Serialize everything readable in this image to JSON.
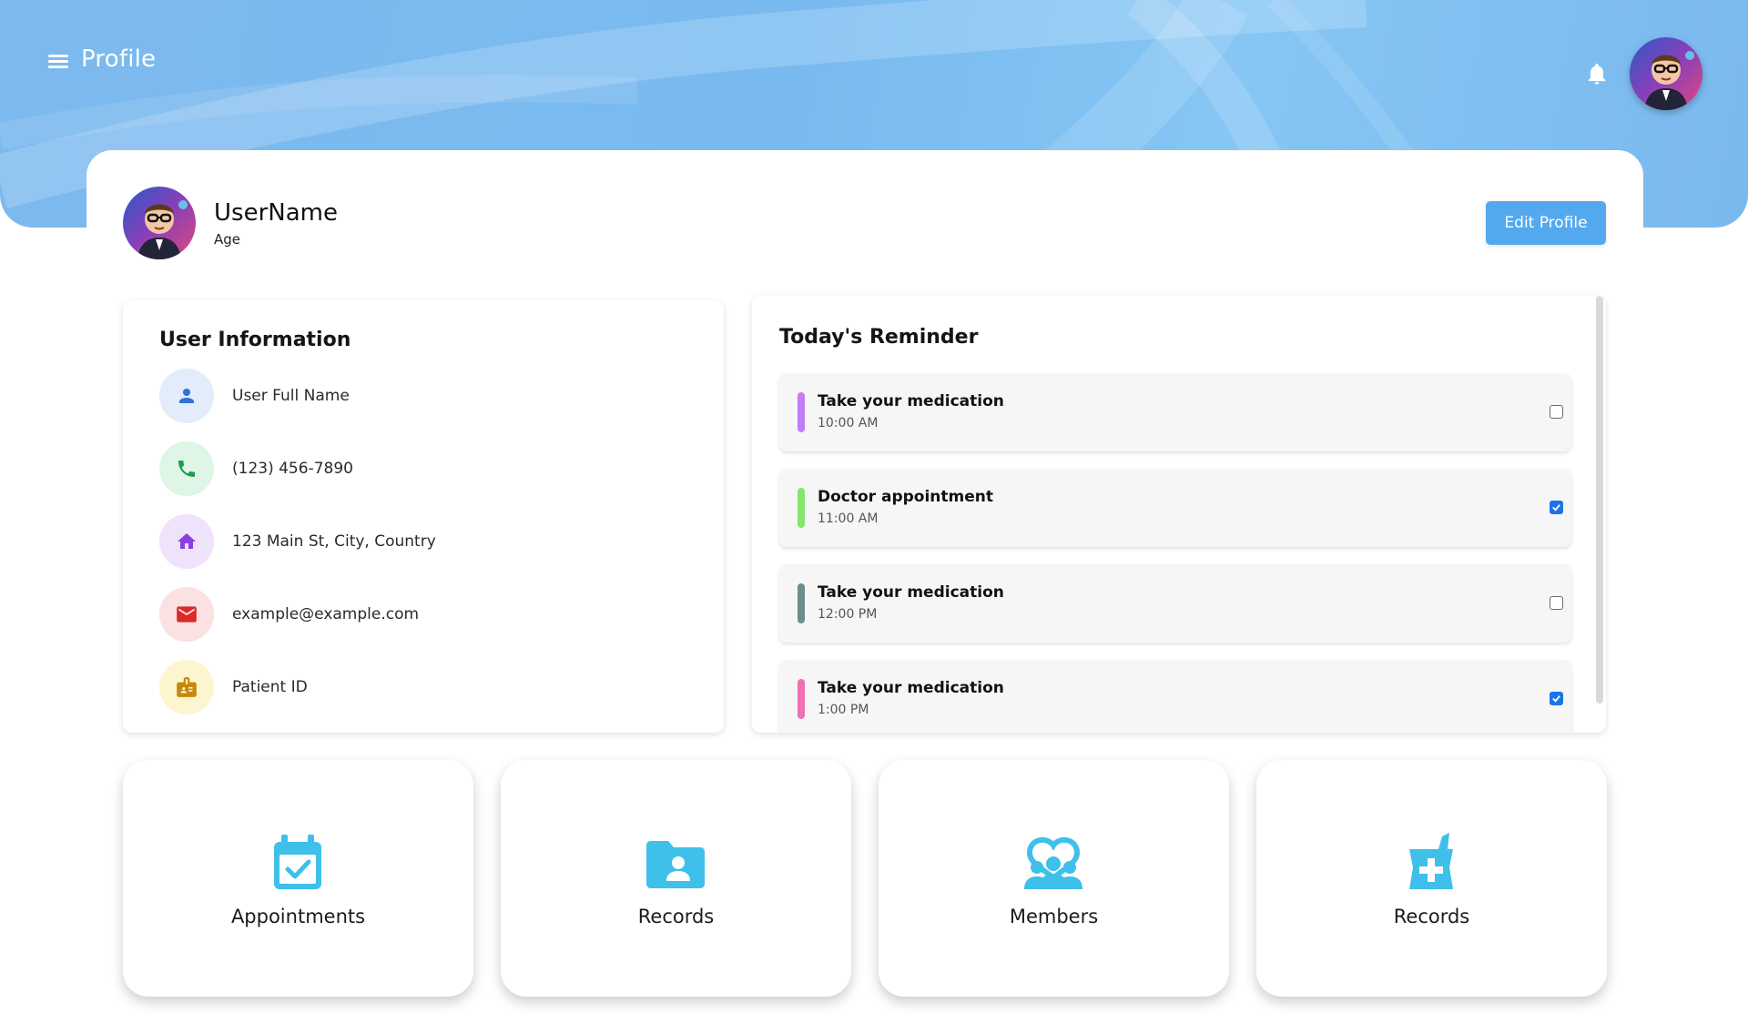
{
  "header": {
    "title": "Profile",
    "menu_icon": "menu-icon",
    "bell_icon": "bell-icon"
  },
  "profile": {
    "username": "UserName",
    "age": "Age",
    "edit_button": "Edit Profile"
  },
  "user_info": {
    "heading": "User Information",
    "items": [
      {
        "icon": "person-icon",
        "text": "User Full Name",
        "color": "#2f6fe0",
        "bg": "#e2ecfb"
      },
      {
        "icon": "phone-icon",
        "text": "(123) 456-7890",
        "color": "#1e9e4a",
        "bg": "#dff5e6"
      },
      {
        "icon": "home-icon",
        "text": "123 Main St, City, Country",
        "color": "#8a3fe0",
        "bg": "#efe3fb"
      },
      {
        "icon": "mail-icon",
        "text": "example@example.com",
        "color": "#dd2a2a",
        "bg": "#fbe1e1"
      },
      {
        "icon": "badge-icon",
        "text": "Patient ID",
        "color": "#c7880c",
        "bg": "#fdf5cf"
      }
    ]
  },
  "reminders": {
    "heading": "Today's Reminder",
    "items": [
      {
        "title": "Take your medication",
        "time": "10:00 AM",
        "color": "#c27cf4",
        "checked": false
      },
      {
        "title": "Doctor appointment",
        "time": "11:00 AM",
        "color": "#84e66b",
        "checked": true
      },
      {
        "title": "Take your medication",
        "time": "12:00 PM",
        "color": "#6b8f8f",
        "checked": false
      },
      {
        "title": "Take your medication",
        "time": "1:00 PM",
        "color": "#f070b4",
        "checked": true
      }
    ]
  },
  "tiles": [
    {
      "label": "Appointments",
      "icon": "calendar-check-icon"
    },
    {
      "label": "Records",
      "icon": "folder-user-icon"
    },
    {
      "label": "Members",
      "icon": "group-icon"
    },
    {
      "label": "Records",
      "icon": "medical-record-icon"
    }
  ],
  "colors": {
    "banner": "#7cb9ee",
    "accent": "#54a9ee",
    "tile_icon": "#3fc0ea",
    "checkbox": "#1a73e8"
  }
}
